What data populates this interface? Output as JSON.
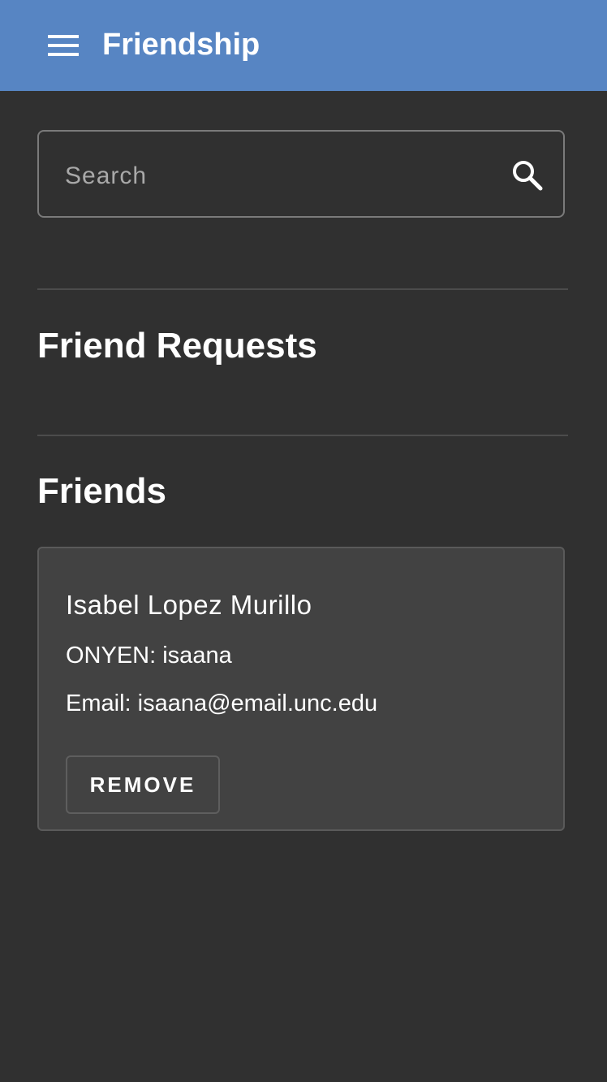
{
  "app": {
    "title": "Friendship",
    "toolbar_color": "#5785c3",
    "background_color": "#303030",
    "menu_icon": "hamburger-menu-icon"
  },
  "search": {
    "placeholder": "Search",
    "value": "",
    "icon": "search-icon"
  },
  "sections": {
    "friend_requests": {
      "title": "Friend Requests",
      "items": []
    },
    "friends": {
      "title": "Friends",
      "items": [
        {
          "name": "Isabel Lopez Murillo",
          "onyen_line": "ONYEN: isaana",
          "email_line": "Email: isaana@email.unc.edu",
          "remove_label": "REMOVE"
        }
      ]
    }
  }
}
